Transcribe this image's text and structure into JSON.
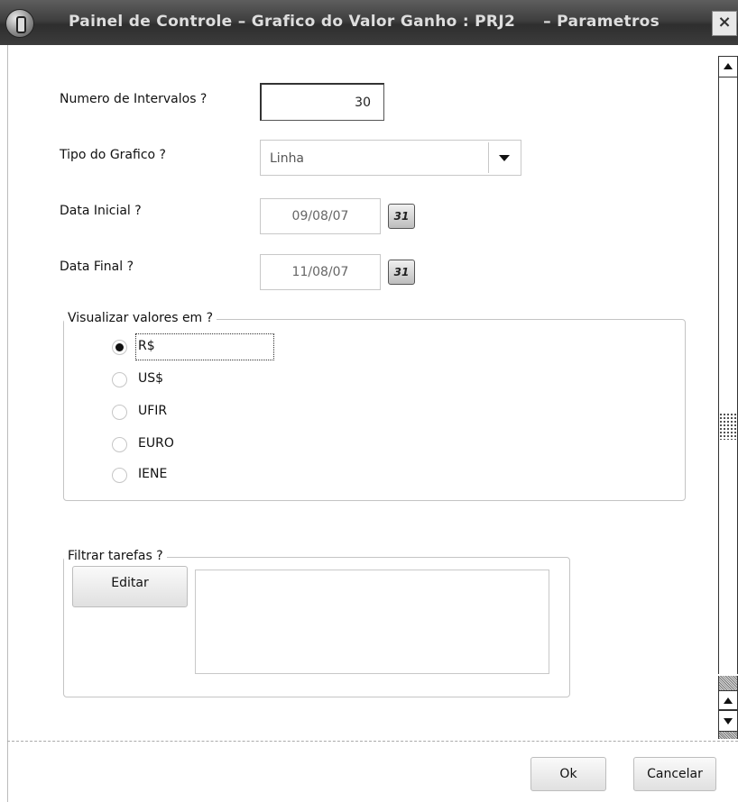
{
  "window": {
    "title": "Painel de Controle – Grafico do Valor Ganho : PRJ2     – Parametros",
    "close_symbol": "×"
  },
  "form": {
    "intervals": {
      "label": "Numero de Intervalos ?",
      "value": "30"
    },
    "chart_type": {
      "label": "Tipo do Grafico ?",
      "value": "Linha"
    },
    "start_date": {
      "label": "Data Inicial ?",
      "value": "09/08/07",
      "calendar_label": "31"
    },
    "end_date": {
      "label": "Data Final ?",
      "value": "11/08/07",
      "calendar_label": "31"
    }
  },
  "currency_group": {
    "legend": "Visualizar valores em  ?",
    "selected": "R$",
    "options": [
      "R$",
      "US$",
      "UFIR",
      "EURO",
      "IENE"
    ]
  },
  "filter_group": {
    "legend": "Filtrar tarefas  ?",
    "edit_button": "Editar",
    "memo_value": ""
  },
  "footer": {
    "ok_button": "Ok",
    "cancel_button": "Cancelar"
  },
  "icons": {
    "app": "totvs-logo-icon",
    "calendar": "calendar-icon",
    "dropdown": "chevron-down-icon",
    "scroll_up": "arrow-up-icon",
    "scroll_down": "arrow-down-icon"
  }
}
